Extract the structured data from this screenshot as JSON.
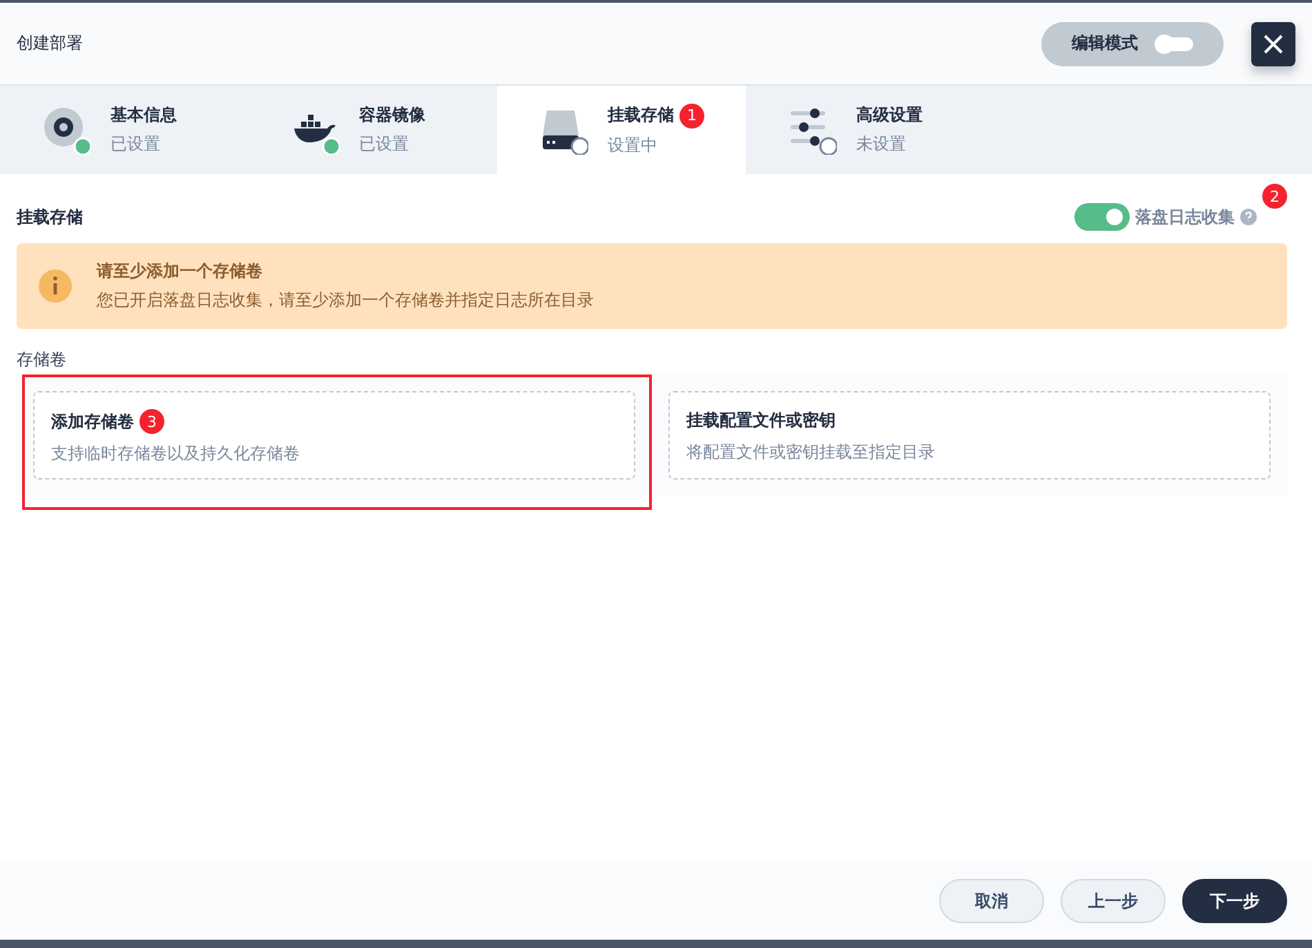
{
  "header": {
    "title": "创建部署",
    "edit_mode": {
      "label": "编辑模式",
      "on": false
    }
  },
  "steps": [
    {
      "kind": "info",
      "title": "基本信息",
      "status": "已设置",
      "done": true,
      "selected": false
    },
    {
      "kind": "image",
      "title": "容器镜像",
      "status": "已设置",
      "done": true,
      "selected": false
    },
    {
      "kind": "storage",
      "title": "挂载存储",
      "status": "设置中",
      "done": false,
      "selected": true,
      "annotation": "1"
    },
    {
      "kind": "advanced",
      "title": "高级设置",
      "status": "未设置",
      "done": false,
      "selected": false
    }
  ],
  "section": {
    "title": "挂载存储",
    "log_toggle": {
      "label": "落盘日志收集",
      "on": true,
      "annotation": "2"
    }
  },
  "alert": {
    "title": "请至少添加一个存储卷",
    "message": "您已开启落盘日志收集，请至少添加一个存储卷并指定日志所在目录"
  },
  "volumes": {
    "label": "存储卷",
    "cards": [
      {
        "title": "添加存储卷",
        "description": "支持临时存储卷以及持久化存储卷",
        "annotation": "3",
        "highlighted": true
      },
      {
        "title": "挂载配置文件或密钥",
        "description": "将配置文件或密钥挂载至指定目录",
        "highlighted": false
      }
    ]
  },
  "footer": {
    "buttons": [
      {
        "label": "取消",
        "primary": false
      },
      {
        "label": "上一步",
        "primary": false
      },
      {
        "label": "下一步",
        "primary": true
      }
    ]
  }
}
